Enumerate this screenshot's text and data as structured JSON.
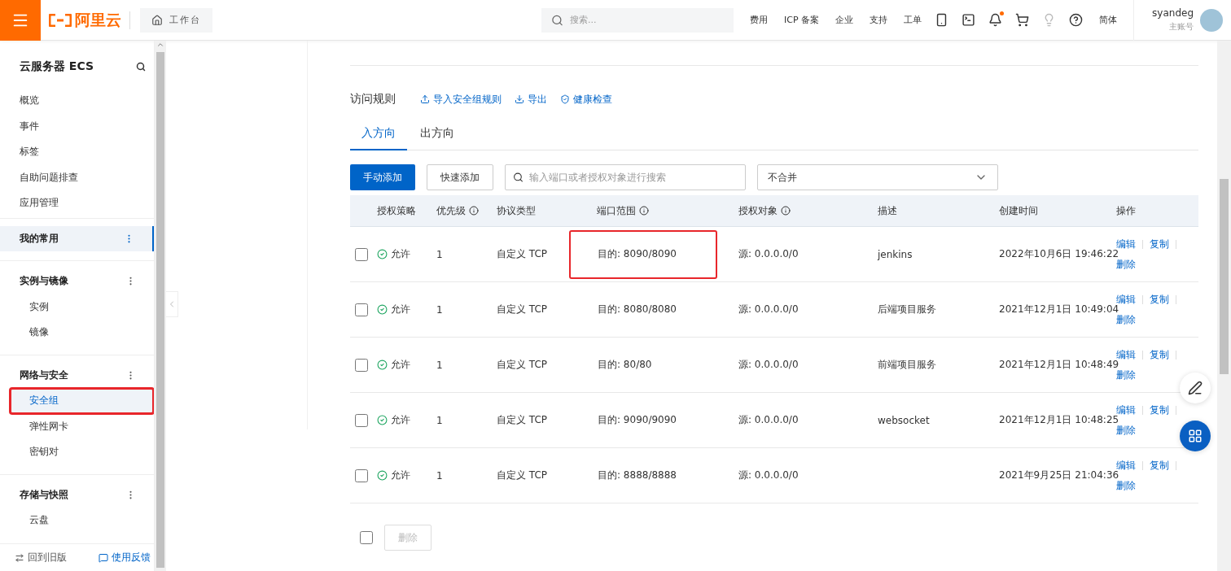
{
  "topbar": {
    "logo": "阿里云",
    "workbench": "工作台",
    "search": {
      "placeholder": "搜索..."
    },
    "nav": [
      "费用",
      "ICP 备案",
      "企业",
      "支持",
      "工单"
    ],
    "notification_dot": true,
    "language": "简体",
    "user": {
      "name": "syandeg",
      "role": "主账号"
    }
  },
  "sidebar": {
    "title": "云服务器 ECS",
    "top_items": [
      {
        "label": "概览"
      },
      {
        "label": "事件"
      },
      {
        "label": "标签"
      },
      {
        "label": "自助问题排查"
      },
      {
        "label": "应用管理"
      }
    ],
    "groups": [
      {
        "label": "我的常用",
        "selected": true
      },
      {
        "label": "实例与镜像",
        "selected": false,
        "items": [
          {
            "label": "实例",
            "selected": false,
            "highlighted": false
          },
          {
            "label": "镜像",
            "selected": false,
            "highlighted": false
          }
        ]
      },
      {
        "label": "网络与安全",
        "selected": false,
        "items": [
          {
            "label": "安全组",
            "selected": true,
            "highlighted": true
          },
          {
            "label": "弹性网卡",
            "selected": false,
            "highlighted": false
          },
          {
            "label": "密钥对",
            "selected": false,
            "highlighted": false
          }
        ]
      },
      {
        "label": "存储与快照",
        "selected": false,
        "items": [
          {
            "label": "云盘",
            "selected": false,
            "highlighted": false
          }
        ]
      }
    ],
    "footer": {
      "back": "回到旧版",
      "feedback": "使用反馈"
    }
  },
  "rules": {
    "title": "访问规则",
    "actions": [
      {
        "kind": "upload",
        "label": "导入安全组规则"
      },
      {
        "kind": "download",
        "label": "导出"
      },
      {
        "kind": "shield",
        "label": "健康检查"
      }
    ],
    "tabs": [
      {
        "label": "入方向",
        "selected": true
      },
      {
        "label": "出方向",
        "selected": false
      }
    ],
    "toolbar": {
      "add": "手动添加",
      "quick_add": "快速添加",
      "search": {
        "placeholder": "输入端口或者授权对象进行搜索"
      },
      "merge": "不合并"
    },
    "columns": [
      {
        "label": "授权策略",
        "info": false
      },
      {
        "label": "优先级",
        "info": true
      },
      {
        "label": "协议类型",
        "info": false
      },
      {
        "label": "端口范围",
        "info": true
      },
      {
        "label": "授权对象",
        "info": true
      },
      {
        "label": "描述",
        "info": false
      },
      {
        "label": "创建时间",
        "info": false
      },
      {
        "label": "操作",
        "info": false
      }
    ],
    "rows": [
      {
        "checked": false,
        "policy": "允许",
        "priority": "1",
        "protocol": "自定义 TCP",
        "port": "目的: 8090/8090",
        "port_highlighted": true,
        "source": "源: 0.0.0.0/0",
        "description": "jenkins",
        "created": "2022年10月6日 19:46:22",
        "actions": [
          "编辑",
          "复制",
          "删除"
        ]
      },
      {
        "checked": false,
        "policy": "允许",
        "priority": "1",
        "protocol": "自定义 TCP",
        "port": "目的: 8080/8080",
        "port_highlighted": false,
        "source": "源: 0.0.0.0/0",
        "description": "后端项目服务",
        "created": "2021年12月1日 10:49:04",
        "actions": [
          "编辑",
          "复制",
          "删除"
        ]
      },
      {
        "checked": false,
        "policy": "允许",
        "priority": "1",
        "protocol": "自定义 TCP",
        "port": "目的: 80/80",
        "port_highlighted": false,
        "source": "源: 0.0.0.0/0",
        "description": "前端项目服务",
        "created": "2021年12月1日 10:48:49",
        "actions": [
          "编辑",
          "复制",
          "删除"
        ]
      },
      {
        "checked": false,
        "policy": "允许",
        "priority": "1",
        "protocol": "自定义 TCP",
        "port": "目的: 9090/9090",
        "port_highlighted": false,
        "source": "源: 0.0.0.0/0",
        "description": "websocket",
        "created": "2021年12月1日 10:48:25",
        "actions": [
          "编辑",
          "复制",
          "删除"
        ]
      },
      {
        "checked": false,
        "policy": "允许",
        "priority": "1",
        "protocol": "自定义 TCP",
        "port": "目的: 8888/8888",
        "port_highlighted": false,
        "source": "源: 0.0.0.0/0",
        "created": "2021年9月25日 21:04:36",
        "actions": [
          "编辑",
          "复制",
          "删除"
        ]
      }
    ],
    "footer": {
      "select_all_checked": false,
      "delete": "删除",
      "delete_disabled": true
    }
  }
}
